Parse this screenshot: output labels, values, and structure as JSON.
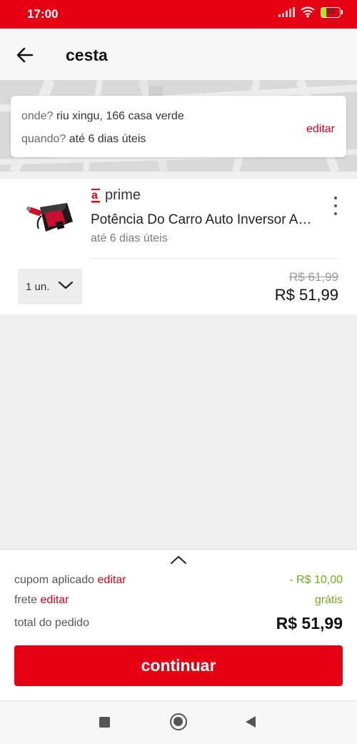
{
  "status_bar": {
    "time": "17:00",
    "battery": "28",
    "battery_percent": 28
  },
  "header": {
    "title": "cesta"
  },
  "delivery": {
    "where_key": "onde?",
    "where_value": "riu xingu, 166 casa verde",
    "when_key": "quando?",
    "when_value": "até 6 dias úteis",
    "edit_label": "editar"
  },
  "item": {
    "brand_text": "prime",
    "title": "Potência Do Carro Auto Inversor Adaptador",
    "eta": "até 6 dias úteis",
    "quantity": "1 un.",
    "old_price": "R$ 61,99",
    "price": "R$ 51,99"
  },
  "summary": {
    "coupon_label": "cupom aplicado",
    "coupon_edit": "editar",
    "coupon_value": "- R$ 10,00",
    "shipping_label": "frete",
    "shipping_edit": "editar",
    "shipping_value": "grátis",
    "total_label": "total do pedido",
    "total_value": "R$ 51,99"
  },
  "continue_button": "continuar",
  "colors": {
    "brand_red": "#e60014",
    "edit_red": "#d0021b",
    "green": "#7aa81e"
  }
}
